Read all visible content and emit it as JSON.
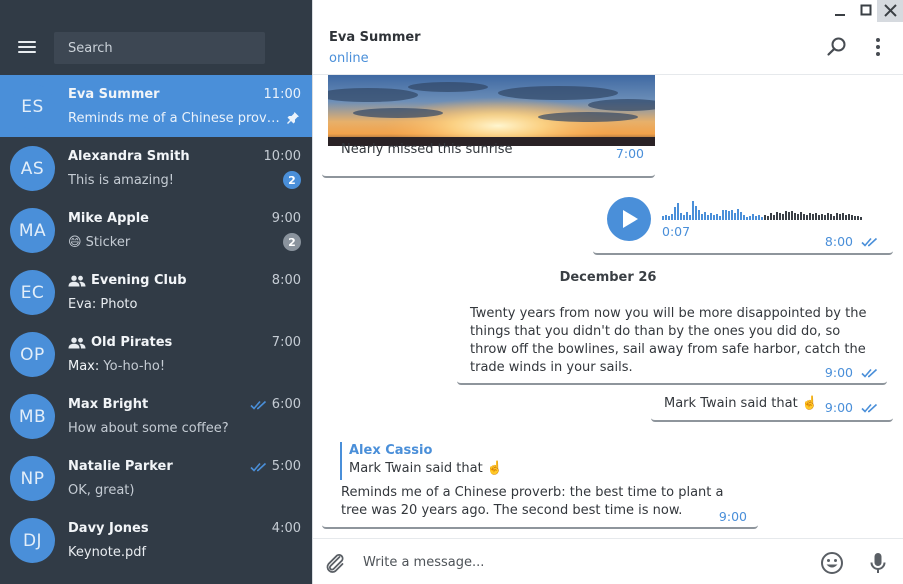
{
  "sidebar": {
    "search_placeholder": "Search",
    "chats": [
      {
        "initials": "ES",
        "name": "Eva Summer",
        "time": "11:00",
        "preview": "Reminds me of a Chinese proverb: the best time to plant a tree",
        "active": true,
        "pinned": true
      },
      {
        "initials": "AS",
        "name": "Alexandra Smith",
        "time": "10:00",
        "preview": "This is amazing!",
        "badge": "2"
      },
      {
        "initials": "MA",
        "name": "Mike Apple",
        "time": "9:00",
        "preview": "😄 Sticker",
        "badge": "2",
        "badge_muted": true
      },
      {
        "initials": "EC",
        "name": "Evening Club",
        "time": "8:00",
        "preview": "Eva: Photo",
        "group": true
      },
      {
        "initials": "OP",
        "name": "Old Pirates",
        "time": "7:00",
        "preview_sender": "Max:",
        "preview": " Yo-ho-ho!",
        "group": true
      },
      {
        "initials": "MB",
        "name": "Max Bright",
        "time": "6:00",
        "preview": "How about some coffee?",
        "read": true
      },
      {
        "initials": "NP",
        "name": "Natalie Parker",
        "time": "5:00",
        "preview": "OK, great)",
        "read": true
      },
      {
        "initials": "DJ",
        "name": "Davy Jones",
        "time": "4:00",
        "preview": "Keynote.pdf"
      }
    ]
  },
  "header": {
    "name": "Eva Summer",
    "status": "online"
  },
  "messages": {
    "photo_caption": "Nearly missed this sunrise",
    "photo_time": "7:00",
    "voice_duration": "0:07",
    "voice_time": "8:00",
    "date_separator": "December 26",
    "quote_text": "Twenty years from now you will be more disappointed by the things that you didn't do than by the ones you did do, so throw off the bowlines, sail away from safe harbor, catch the trade winds in your sails.",
    "quote_time": "9:00",
    "twain_text": "Mark Twain said that ☝️",
    "twain_time": "9:00",
    "reply_author": "Alex Cassio",
    "reply_quote": "Mark Twain said that ☝️",
    "reply_text": "Reminds me of a Chinese proverb: the best time to plant a tree was 20 years ago. The second best time is now.",
    "reply_time": "9:00"
  },
  "composer": {
    "placeholder": "Write a message..."
  },
  "colors": {
    "accent": "#4a8fd9",
    "sidebar_bg": "#313b46",
    "search_bg": "#3d4753"
  },
  "icons": {
    "menu": "hamburger-icon",
    "search": "search-icon",
    "more": "more-vertical-icon",
    "attach": "paperclip-icon",
    "emoji": "emoji-icon",
    "mic": "microphone-icon",
    "pin": "pin-icon",
    "group": "group-icon",
    "read": "double-check-icon",
    "play": "play-icon"
  }
}
